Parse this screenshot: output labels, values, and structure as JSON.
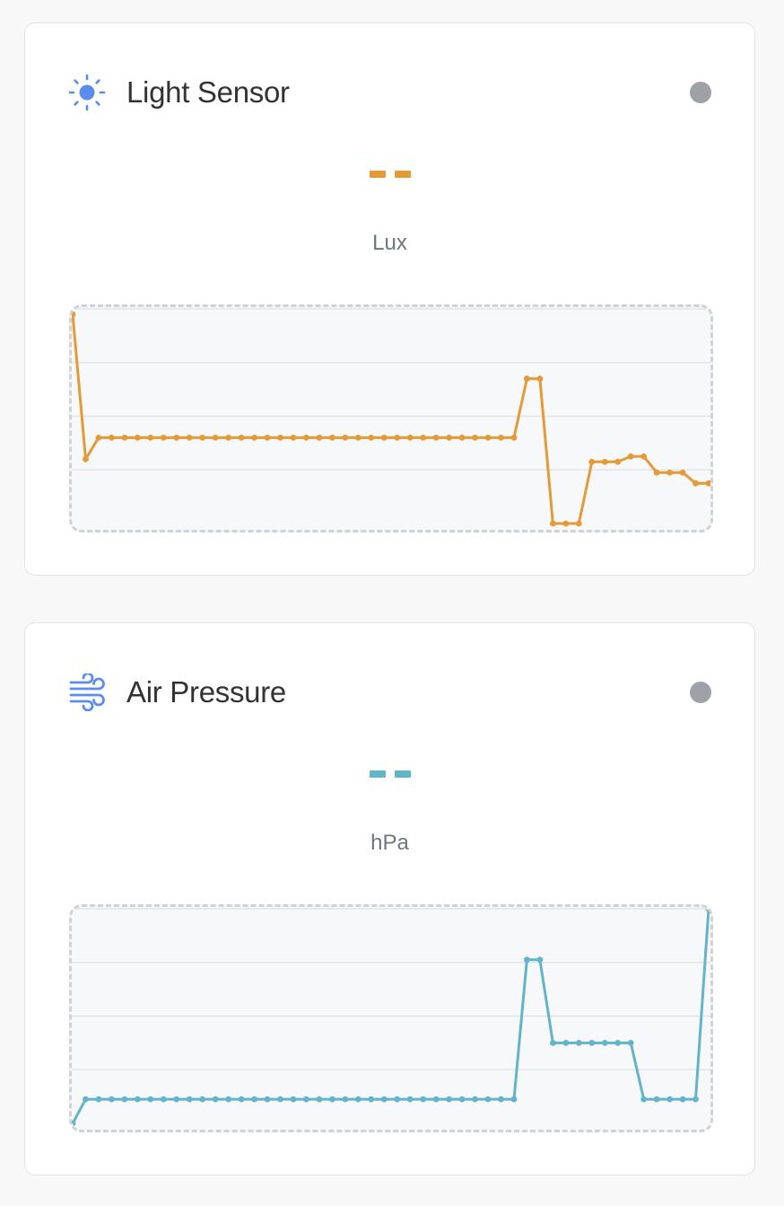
{
  "cards": [
    {
      "title": "Light Sensor",
      "icon": "sun-icon",
      "value": "- -",
      "unit": "Lux",
      "accent": "#e59a38",
      "status_color": "#9ea1a8",
      "chart_data": {
        "type": "line",
        "x": [
          1,
          2,
          3,
          4,
          5,
          6,
          7,
          8,
          9,
          10,
          11,
          12,
          13,
          14,
          15,
          16,
          17,
          18,
          19,
          20,
          21,
          22,
          23,
          24,
          25,
          26,
          27,
          28,
          29,
          30,
          31,
          32,
          33,
          34,
          35,
          36,
          37,
          38,
          39,
          40,
          41,
          42,
          43,
          44,
          45,
          46,
          47,
          48,
          49,
          50
        ],
        "values": [
          3.9,
          1.2,
          1.6,
          1.6,
          1.6,
          1.6,
          1.6,
          1.6,
          1.6,
          1.6,
          1.6,
          1.6,
          1.6,
          1.6,
          1.6,
          1.6,
          1.6,
          1.6,
          1.6,
          1.6,
          1.6,
          1.6,
          1.6,
          1.6,
          1.6,
          1.6,
          1.6,
          1.6,
          1.6,
          1.6,
          1.6,
          1.6,
          1.6,
          1.6,
          1.6,
          2.7,
          2.7,
          0,
          0,
          0,
          1.15,
          1.15,
          1.15,
          1.25,
          1.25,
          0.95,
          0.95,
          0.95,
          0.75,
          0.75
        ],
        "ylim": [
          0,
          4
        ],
        "grid": true
      }
    },
    {
      "title": "Air Pressure",
      "icon": "wind-icon",
      "value": "- -",
      "unit": "hPa",
      "accent": "#63b3c9",
      "status_color": "#9ea1a8",
      "chart_data": {
        "type": "line",
        "x": [
          1,
          2,
          3,
          4,
          5,
          6,
          7,
          8,
          9,
          10,
          11,
          12,
          13,
          14,
          15,
          16,
          17,
          18,
          19,
          20,
          21,
          22,
          23,
          24,
          25,
          26,
          27,
          28,
          29,
          30,
          31,
          32,
          33,
          34,
          35,
          36,
          37,
          38,
          39,
          40,
          41,
          42,
          43,
          44,
          45,
          46,
          47,
          48,
          49,
          50
        ],
        "values": [
          0,
          0.45,
          0.45,
          0.45,
          0.45,
          0.45,
          0.45,
          0.45,
          0.45,
          0.45,
          0.45,
          0.45,
          0.45,
          0.45,
          0.45,
          0.45,
          0.45,
          0.45,
          0.45,
          0.45,
          0.45,
          0.45,
          0.45,
          0.45,
          0.45,
          0.45,
          0.45,
          0.45,
          0.45,
          0.45,
          0.45,
          0.45,
          0.45,
          0.45,
          0.45,
          3.05,
          3.05,
          1.5,
          1.5,
          1.5,
          1.5,
          1.5,
          1.5,
          1.5,
          0.45,
          0.45,
          0.45,
          0.45,
          0.45,
          4
        ],
        "ylim": [
          0,
          4
        ],
        "grid": true
      }
    }
  ]
}
